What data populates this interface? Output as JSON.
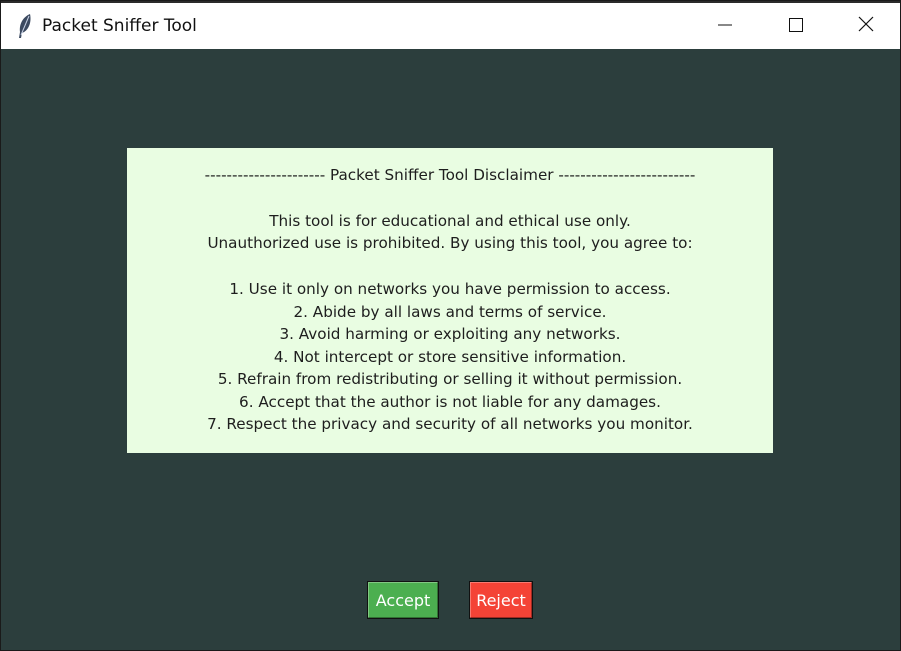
{
  "window": {
    "title": "Packet Sniffer Tool"
  },
  "disclaimer": {
    "heading": "---------------------- Packet Sniffer Tool Disclaimer -------------------------",
    "intro_1": "This tool is for educational and ethical use only.",
    "intro_2": "Unauthorized use is prohibited. By using this tool, you agree to:",
    "items": [
      "1. Use it only on networks you have permission to access.",
      "2. Abide by all laws and terms of service.",
      "3. Avoid harming or exploiting any networks.",
      "4. Not intercept or store sensitive information.",
      "5. Refrain from redistributing or selling it without permission.",
      "6. Accept that the author is not liable for any damages.",
      "7. Respect the privacy and security of all networks you monitor."
    ]
  },
  "buttons": {
    "accept_label": "Accept",
    "reject_label": "Reject"
  },
  "colors": {
    "background": "#2c3e3d",
    "panel": "#e9fde2",
    "accept": "#4caf50",
    "reject": "#f44336"
  },
  "icons": {
    "app": "feather-icon",
    "minimize": "minimize-icon",
    "maximize": "maximize-icon",
    "close": "close-icon"
  }
}
